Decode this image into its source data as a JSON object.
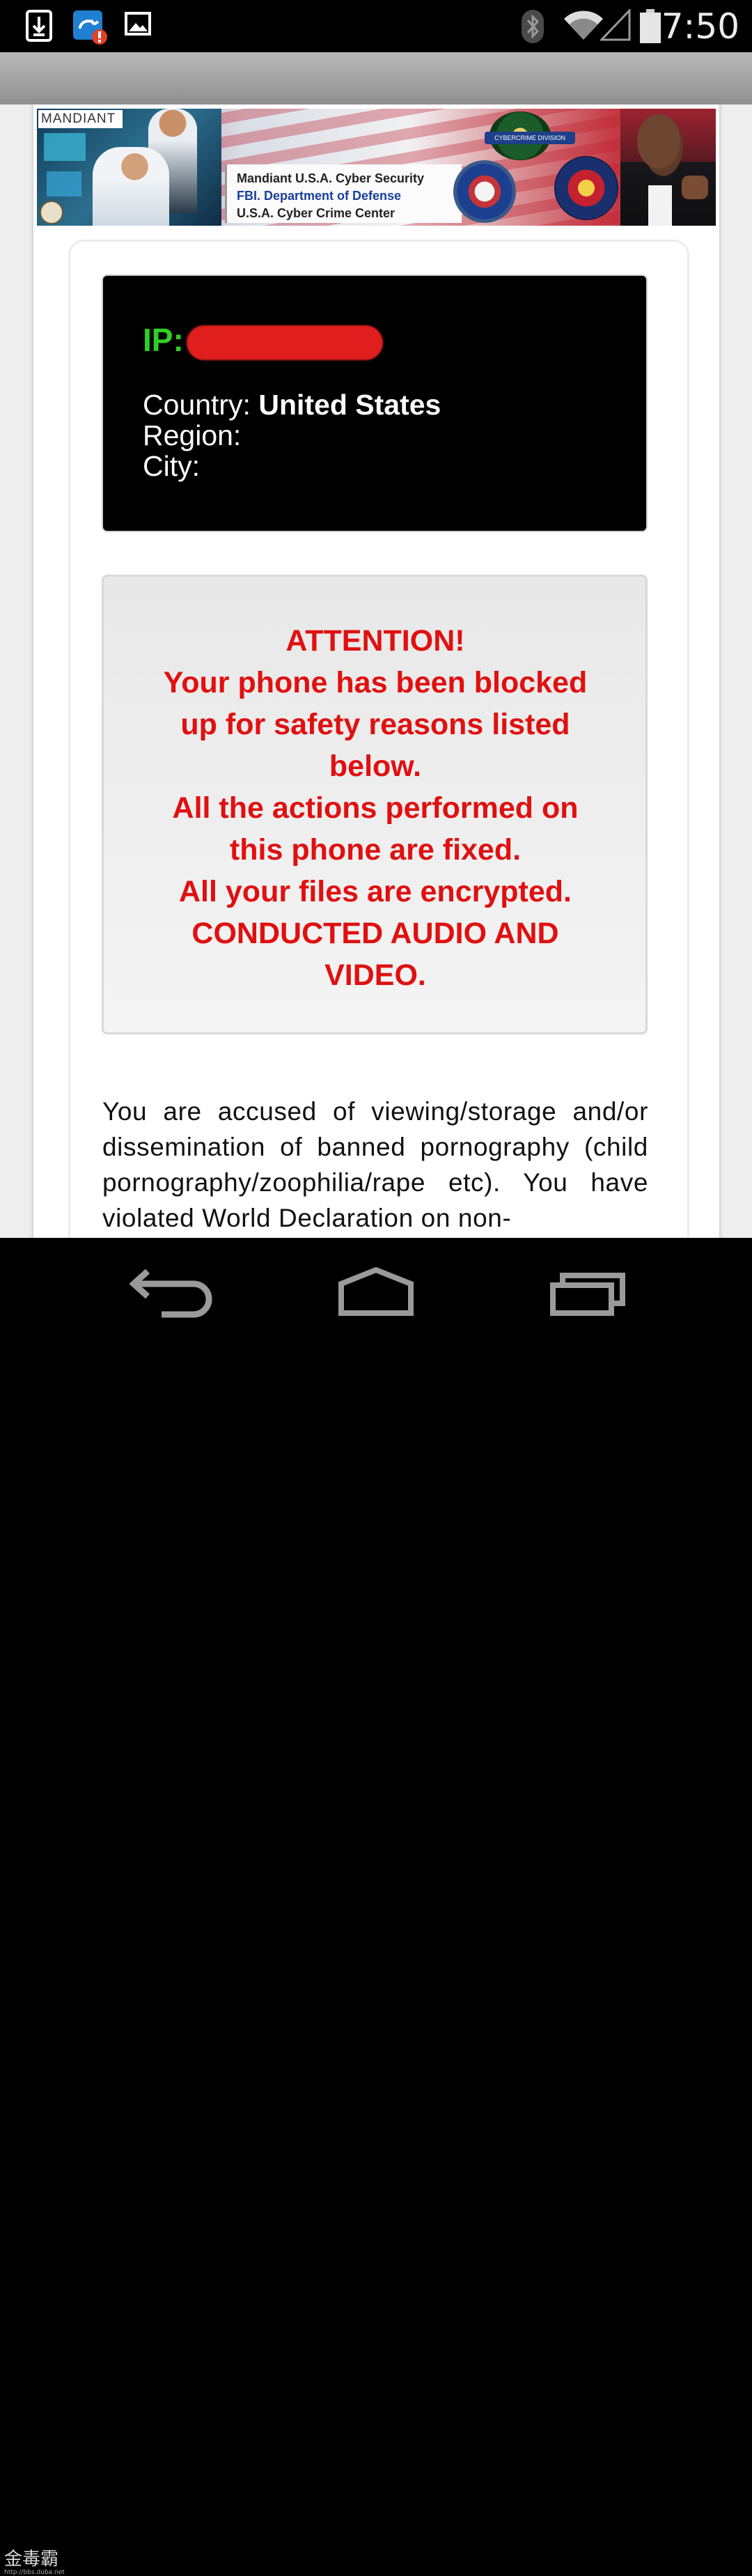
{
  "status_bar": {
    "time": "7:50",
    "icons_left": [
      "download-icon",
      "sync-alert-icon",
      "image-icon"
    ],
    "icons_right": [
      "bluetooth-icon",
      "wifi-icon",
      "cell-signal-icon",
      "battery-icon"
    ]
  },
  "banner": {
    "logo": "MANDIANT",
    "lines": [
      "Mandiant U.S.A. Cyber Security",
      "FBI. Department of Defense",
      "U.S.A. Cyber Crime Center"
    ],
    "seal_label": "CYBERCRIME DIVISION"
  },
  "ip_panel": {
    "ip_label": "IP:",
    "country_label": "Country:",
    "country_value": "United States",
    "region_label": "Region:",
    "region_value": "",
    "city_label": "City:",
    "city_value": ""
  },
  "alert": {
    "lines": [
      "ATTENTION!",
      "Your phone has been blocked",
      "up for safety reasons listed",
      "below.",
      "All the actions performed on",
      "this phone are fixed.",
      "All your files are encrypted.",
      "CONDUCTED AUDIO AND",
      "VIDEO."
    ]
  },
  "body_text": "You are accused of viewing/storage and/or dissemination of banned pornography (child pornography/zoophilia/rape etc). You have violated World Declaration on non-",
  "watermark": {
    "text": "金毒霸",
    "url": "http://bbs.duba.net"
  },
  "colors": {
    "alert_red": "#e01010",
    "ip_green": "#31cf25",
    "status_bg": "#000000"
  }
}
